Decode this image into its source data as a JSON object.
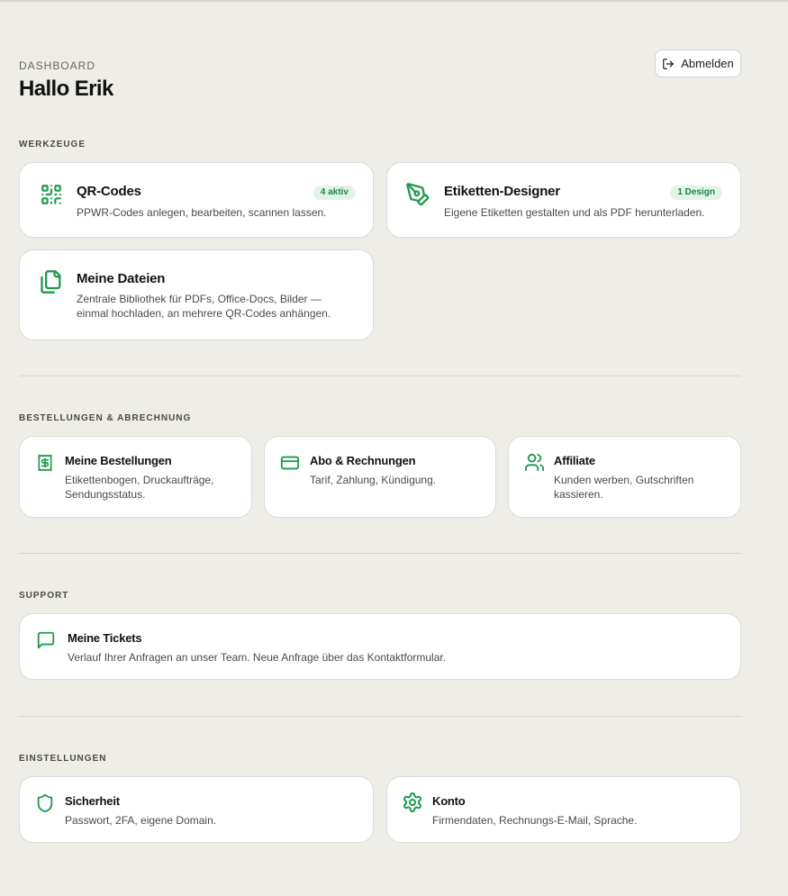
{
  "header": {
    "eyebrow": "DASHBOARD",
    "greeting": "Hallo Erik",
    "logout_label": "Abmelden"
  },
  "sections": {
    "tools": {
      "label": "WERKZEUGE",
      "cards": [
        {
          "title": "QR-Codes",
          "desc": "PPWR-Codes anlegen, bearbeiten, scannen lassen.",
          "badge": "4 aktiv",
          "icon": "qr-code-icon"
        },
        {
          "title": "Etiketten-Designer",
          "desc": "Eigene Etiketten gestalten und als PDF herunterladen.",
          "badge": "1 Design",
          "icon": "pen-tool-icon"
        },
        {
          "title": "Meine Dateien",
          "desc": "Zentrale Bibliothek für PDFs, Office-Docs, Bilder — einmal hochladen, an mehrere QR-Codes anhängen.",
          "icon": "files-icon"
        }
      ]
    },
    "orders": {
      "label": "BESTELLUNGEN & ABRECHNUNG",
      "cards": [
        {
          "title": "Meine Bestellungen",
          "desc": "Etikettenbogen, Druckaufträge, Sendungsstatus.",
          "icon": "receipt-icon"
        },
        {
          "title": "Abo & Rechnungen",
          "desc": "Tarif, Zahlung, Kündigung.",
          "icon": "credit-card-icon"
        },
        {
          "title": "Affiliate",
          "desc": "Kunden werben, Gutschriften kassieren.",
          "icon": "users-icon"
        }
      ]
    },
    "support": {
      "label": "SUPPORT",
      "cards": [
        {
          "title": "Meine Tickets",
          "desc": "Verlauf Ihrer Anfragen an unser Team. Neue Anfrage über das Kontaktformular.",
          "icon": "message-square-icon"
        }
      ]
    },
    "settings": {
      "label": "EINSTELLUNGEN",
      "cards": [
        {
          "title": "Sicherheit",
          "desc": "Passwort, 2FA, eigene Domain.",
          "icon": "shield-icon"
        },
        {
          "title": "Konto",
          "desc": "Firmendaten, Rechnungs-E-Mail, Sprache.",
          "icon": "settings-gear-icon"
        }
      ]
    }
  },
  "colors": {
    "background": "#efede8",
    "accent": "#1f9a4e",
    "badge_bg": "#e2f4e8",
    "card_border": "#dcdad4"
  }
}
